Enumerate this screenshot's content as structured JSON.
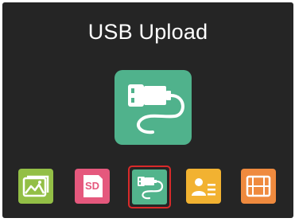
{
  "screen": {
    "title": "USB Upload"
  },
  "hero": {
    "icon": "usb-cable-icon",
    "color": "#50b28c"
  },
  "dock": {
    "items": [
      {
        "name": "gallery",
        "icon": "image-gallery-icon",
        "color": "#93bf46"
      },
      {
        "name": "sd-card",
        "icon": "sd-card-icon",
        "label": "SD",
        "color": "#e5587d"
      },
      {
        "name": "usb",
        "icon": "usb-cable-icon",
        "color": "#52b48c",
        "selected": true
      },
      {
        "name": "contacts",
        "icon": "contact-card-icon",
        "color": "#f2b231"
      },
      {
        "name": "video",
        "icon": "film-strip-icon",
        "color": "#ef8a3e"
      }
    ]
  },
  "colors": {
    "background": "#252525",
    "selection": "#d92a2a"
  }
}
